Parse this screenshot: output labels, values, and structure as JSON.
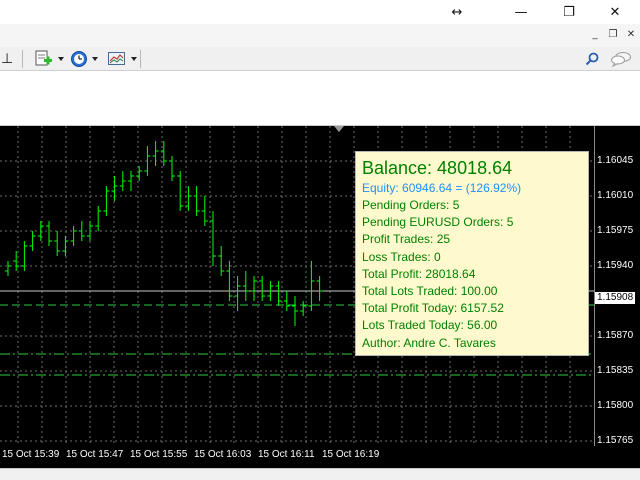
{
  "window": {
    "resize_glyph": "↔",
    "minimize_glyph": "—",
    "restore_glyph": "❐",
    "close_glyph": "✕"
  },
  "mdi": {
    "minimize_glyph": "_",
    "restore_glyph": "❐",
    "close_glyph": "✕"
  },
  "toolbar": {
    "crosshair_glyph": "⊥",
    "new_order_icon": "new-order-icon",
    "clock_icon": "clock-icon",
    "template_icon": "chart-template-icon"
  },
  "colors": {
    "candle": "#00ff00",
    "grid": "#6e6e6e",
    "balance": "#008000",
    "equity": "#1e90ff",
    "panel_bg": "#fffacd"
  },
  "chart": {
    "current_price": "1.15908",
    "price_levels": [
      "1.16045",
      "1.16010",
      "1.15975",
      "1.15940",
      "1.15870",
      "1.15835",
      "1.15800",
      "1.15765"
    ],
    "time_labels": [
      "15 Oct 15:39",
      "15 Oct 15:47",
      "15 Oct 15:55",
      "15 Oct 16:03",
      "15 Oct 16:11",
      "15 Oct 16:19"
    ]
  },
  "chart_data": {
    "type": "candlestick",
    "ylim": [
      1.1576,
      1.1608
    ],
    "levels": [
      1.15915,
      1.15901,
      1.15852,
      1.15831
    ],
    "candles": [
      [
        1.15935,
        1.15945,
        1.1593,
        1.1594
      ],
      [
        1.15945,
        1.15955,
        1.15935,
        1.1594
      ],
      [
        1.1594,
        1.15965,
        1.15935,
        1.1596
      ],
      [
        1.1596,
        1.15975,
        1.15955,
        1.1597
      ],
      [
        1.1597,
        1.15985,
        1.15965,
        1.1598
      ],
      [
        1.1598,
        1.15985,
        1.1596,
        1.15965
      ],
      [
        1.15965,
        1.15975,
        1.1595,
        1.15955
      ],
      [
        1.15955,
        1.1597,
        1.1595,
        1.15965
      ],
      [
        1.15965,
        1.1598,
        1.1596,
        1.15975
      ],
      [
        1.15975,
        1.15985,
        1.15965,
        1.1597
      ],
      [
        1.1597,
        1.15985,
        1.15965,
        1.1598
      ],
      [
        1.1598,
        1.16,
        1.15975,
        1.15995
      ],
      [
        1.15995,
        1.1602,
        1.1599,
        1.16015
      ],
      [
        1.16015,
        1.1603,
        1.16005,
        1.1602
      ],
      [
        1.1602,
        1.16035,
        1.16015,
        1.16025
      ],
      [
        1.16025,
        1.16035,
        1.16015,
        1.1603
      ],
      [
        1.1603,
        1.1604,
        1.16025,
        1.16035
      ],
      [
        1.16035,
        1.1606,
        1.1603,
        1.1605
      ],
      [
        1.1605,
        1.16065,
        1.1604,
        1.16055
      ],
      [
        1.16055,
        1.16065,
        1.1604,
        1.16045
      ],
      [
        1.16045,
        1.1605,
        1.16025,
        1.1603
      ],
      [
        1.1603,
        1.16035,
        1.15995,
        1.16
      ],
      [
        1.16,
        1.1602,
        1.15995,
        1.1601
      ],
      [
        1.1601,
        1.1602,
        1.1599,
        1.15995
      ],
      [
        1.15995,
        1.1601,
        1.1598,
        1.15985
      ],
      [
        1.15985,
        1.15995,
        1.1594,
        1.1595
      ],
      [
        1.1595,
        1.1596,
        1.1593,
        1.15935
      ],
      [
        1.15935,
        1.15945,
        1.15905,
        1.1591
      ],
      [
        1.1591,
        1.1593,
        1.15895,
        1.1592
      ],
      [
        1.1592,
        1.15935,
        1.15905,
        1.15915
      ],
      [
        1.15915,
        1.1593,
        1.15905,
        1.15925
      ],
      [
        1.15925,
        1.1593,
        1.15905,
        1.1591
      ],
      [
        1.1591,
        1.15925,
        1.15905,
        1.1592
      ],
      [
        1.1592,
        1.15925,
        1.159,
        1.15905
      ],
      [
        1.15905,
        1.15915,
        1.15895,
        1.159
      ],
      [
        1.159,
        1.1591,
        1.1588,
        1.15895
      ],
      [
        1.15895,
        1.15905,
        1.1589,
        1.159
      ],
      [
        1.159,
        1.15945,
        1.15895,
        1.15925
      ],
      [
        1.15925,
        1.1593,
        1.15905,
        1.15915
      ]
    ]
  },
  "panel": {
    "balance": "Balance: 48018.64",
    "equity": "Equity: 60946.64 = (126.92%)",
    "pending_orders": "Pending Orders: 5",
    "pending_symbol_orders": "Pending EURUSD Orders: 5",
    "profit_trades": "Profit Trades: 25",
    "loss_trades": "Loss Trades: 0",
    "total_profit": "Total Profit: 28018.64",
    "total_lots": "Total Lots Traded: 100.00",
    "profit_today": "Total Profit Today: 6157.52",
    "lots_today": "Lots Traded Today: 56.00",
    "author": "Author: Andre C. Tavares"
  }
}
